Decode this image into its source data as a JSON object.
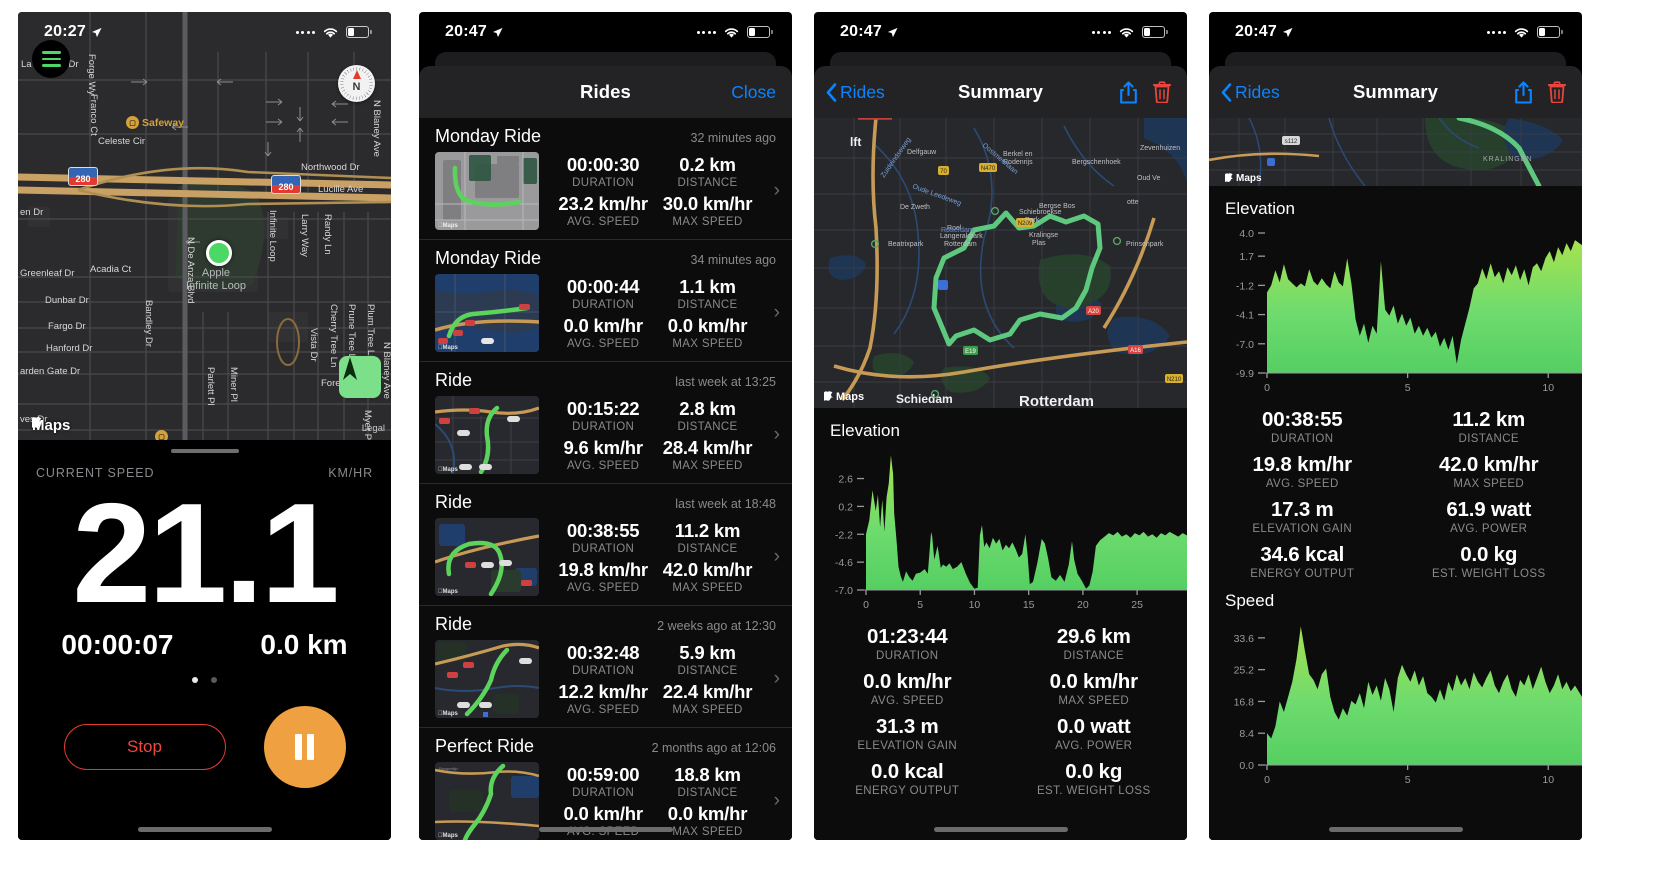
{
  "accent_blue": "#0a84ff",
  "accent_green": "#6fdc6f",
  "accent_orange": "#efa040",
  "accent_red": "#e03a32",
  "panel1": {
    "status": {
      "time": "20:27",
      "location_icon": "location-arrow-icon",
      "cellular": "....",
      "wifi_icon": "wifi-icon",
      "battery_icon": "battery-icon"
    },
    "map": {
      "attribution": "Maps",
      "legal": "Legal",
      "user_location_label": "Apple\nInfinite Loop",
      "poi": "Safeway",
      "highway_shields": [
        "280",
        "280"
      ],
      "street_labels": [
        "La Grande Dr",
        "Forge Wy",
        "Franco Ct",
        "Celeste Cir",
        "Northwood Dr",
        "N Blaney Ave",
        "Lucille Ave",
        "en Dr",
        "Greenleaf Dr",
        "Acadia Ct",
        "Dunbar Dr",
        "Fargo Dr",
        "Hanford Dr",
        "arden Gate Dr",
        "ves Dr",
        "N De Anza Blvd",
        "Bandley Dr",
        "Parlett Pl",
        "Miner Pl",
        "Infinite Loop",
        "Larry Way",
        "Randy Ln",
        "Vista Dr",
        "Cherry Tree Ln",
        "Prune Tree Ln",
        "Plum Tree Ln",
        "N Blaney Ave",
        "Forest Ave",
        "Myer Pl"
      ]
    },
    "live": {
      "speed_label": "CURRENT SPEED",
      "unit_label": "KM/HR",
      "speed_value": "21.1",
      "duration": "00:00:07",
      "distance": "0.0 km",
      "stop_label": "Stop",
      "pause_icon": "pause-icon",
      "page_count": 2,
      "page_active": 0
    }
  },
  "panel2": {
    "status": {
      "time": "20:47",
      "cellular": "....",
      "wifi_icon": "wifi-icon",
      "battery_icon": "battery-icon"
    },
    "navbar": {
      "title": "Rides",
      "close_label": "Close"
    },
    "rides": [
      {
        "name": "Monday Ride",
        "when": "32 minutes ago",
        "duration": "00:00:30",
        "distance": "0.2 km",
        "avg_speed": "23.2 km/hr",
        "max_speed": "30.0 km/hr",
        "labels": {
          "duration": "DURATION",
          "distance": "DISTANCE",
          "avg_speed": "AVG. SPEED",
          "max_speed": "MAX SPEED"
        },
        "thumb_style": "light"
      },
      {
        "name": "Monday Ride",
        "when": "34 minutes ago",
        "duration": "00:00:44",
        "distance": "1.1 km",
        "avg_speed": "0.0 km/hr",
        "max_speed": "0.0 km/hr",
        "labels": {
          "duration": "DURATION",
          "distance": "DISTANCE",
          "avg_speed": "AVG. SPEED",
          "max_speed": "MAX SPEED"
        },
        "thumb_style": "water"
      },
      {
        "name": "Ride",
        "when": "last week at 13:25",
        "duration": "00:15:22",
        "distance": "2.8 km",
        "avg_speed": "9.6 km/hr",
        "max_speed": "28.4 km/hr",
        "labels": {
          "duration": "DURATION",
          "distance": "DISTANCE",
          "avg_speed": "AVG. SPEED",
          "max_speed": "MAX SPEED"
        },
        "thumb_style": "dark"
      },
      {
        "name": "Ride",
        "when": "last week at 18:48",
        "duration": "00:38:55",
        "distance": "11.2 km",
        "avg_speed": "19.8 km/hr",
        "max_speed": "42.0 km/hr",
        "labels": {
          "duration": "DURATION",
          "distance": "DISTANCE",
          "avg_speed": "AVG. SPEED",
          "max_speed": "MAX SPEED"
        },
        "thumb_style": "loop"
      },
      {
        "name": "Ride",
        "when": "2 weeks ago at 12:30",
        "duration": "00:32:48",
        "distance": "5.9 km",
        "avg_speed": "12.2 km/hr",
        "max_speed": "22.4 km/hr",
        "labels": {
          "duration": "DURATION",
          "distance": "DISTANCE",
          "avg_speed": "AVG. SPEED",
          "max_speed": "MAX SPEED"
        },
        "thumb_style": "dark"
      },
      {
        "name": "Perfect Ride",
        "when": "2 months ago at 12:06",
        "duration": "00:59:00",
        "distance": "18.8 km",
        "avg_speed": "0.0 km/hr",
        "max_speed": "0.0 km/hr",
        "labels": {
          "duration": "DURATION",
          "distance": "DISTANCE",
          "avg_speed": "AVG. SPEED",
          "max_speed": "MAX SPEED"
        },
        "thumb_style": "dark"
      }
    ]
  },
  "panel3": {
    "status": {
      "time": "20:47",
      "cellular": "....",
      "wifi_icon": "wifi-icon",
      "battery_icon": "battery-icon"
    },
    "navbar": {
      "back_label": "Rides",
      "title": "Summary",
      "share_icon": "share-icon",
      "delete_icon": "trash-icon"
    },
    "map": {
      "attribution": "Maps",
      "place_labels": [
        "lft",
        "Delfgauw",
        "Berkel en Rodenrijs",
        "Bergschenhoek",
        "Zevenhuizen",
        "Oud Ve",
        "De Zweth",
        "Schiebroekse Park",
        "Bergse Bos",
        "otte",
        "Beatrixpark",
        "Schiedam",
        "Roel Langerakpark Rotterdam",
        "Rotterdam",
        "Prinsenpark",
        "Kralingse Plas"
      ],
      "road_shields": [
        "N470",
        "N209",
        "N219",
        "E19",
        "A20",
        "A16"
      ]
    },
    "elevation": {
      "title": "Elevation",
      "yticks": [
        "2.6",
        "0.2",
        "-2.2",
        "-4.6",
        "-7.0"
      ],
      "xticks": [
        "0",
        "5",
        "10",
        "15",
        "20",
        "25"
      ]
    },
    "stats": [
      {
        "value": "01:23:44",
        "label": "DURATION"
      },
      {
        "value": "29.6 km",
        "label": "DISTANCE"
      },
      {
        "value": "0.0 km/hr",
        "label": "AVG. SPEED"
      },
      {
        "value": "0.0 km/hr",
        "label": "MAX SPEED"
      },
      {
        "value": "31.3 m",
        "label": "ELEVATION GAIN"
      },
      {
        "value": "0.0 watt",
        "label": "AVG. POWER"
      },
      {
        "value": "0.0 kcal",
        "label": "ENERGY OUTPUT"
      },
      {
        "value": "0.0 kg",
        "label": "EST. WEIGHT LOSS"
      }
    ]
  },
  "panel4": {
    "status": {
      "time": "20:47",
      "cellular": "....",
      "wifi_icon": "wifi-icon",
      "battery_icon": "battery-icon"
    },
    "navbar": {
      "back_label": "Rides",
      "title": "Summary",
      "share_icon": "share-icon",
      "delete_icon": "trash-icon"
    },
    "map": {
      "attribution": "Maps",
      "place_labels": [
        "s112",
        "KRALINGEN"
      ]
    },
    "elevation": {
      "title": "Elevation",
      "yticks": [
        "4.0",
        "1.7",
        "-1.2",
        "-4.1",
        "-7.0",
        "-9.9"
      ],
      "xticks": [
        "0",
        "5",
        "10"
      ]
    },
    "stats": [
      {
        "value": "00:38:55",
        "label": "DURATION"
      },
      {
        "value": "11.2 km",
        "label": "DISTANCE"
      },
      {
        "value": "19.8 km/hr",
        "label": "AVG. SPEED"
      },
      {
        "value": "42.0 km/hr",
        "label": "MAX SPEED"
      },
      {
        "value": "17.3 m",
        "label": "ELEVATION GAIN"
      },
      {
        "value": "61.9 watt",
        "label": "AVG. POWER"
      },
      {
        "value": "34.6 kcal",
        "label": "ENERGY OUTPUT"
      },
      {
        "value": "0.0 kg",
        "label": "EST. WEIGHT LOSS"
      }
    ],
    "speed": {
      "title": "Speed",
      "yticks": [
        "33.6",
        "25.2",
        "16.8",
        "8.4",
        "0.0"
      ],
      "xticks": [
        "0",
        "5",
        "10"
      ]
    }
  },
  "chart_data": [
    {
      "type": "area",
      "title": "Elevation",
      "panel": 3,
      "xlabel": "",
      "ylabel": "",
      "xlim": [
        0,
        29.6
      ],
      "ylim": [
        -7.0,
        4.8
      ],
      "yticks": [
        2.6,
        0.2,
        -2.2,
        -4.6,
        -7.0
      ],
      "xticks": [
        0,
        5,
        10,
        15,
        20,
        25
      ],
      "grid": false,
      "series": [
        {
          "name": "elevation",
          "x": [
            0,
            0.3,
            0.6,
            0.9,
            1.1,
            1.3,
            1.5,
            1.7,
            1.9,
            2.1,
            2.3,
            2.5,
            2.6,
            2.8,
            3.0,
            3.2,
            3.4,
            3.7,
            4.0,
            4.3,
            4.6,
            5.0,
            5.4,
            5.7,
            6.0,
            6.1,
            6.3,
            6.6,
            6.9,
            7.1,
            7.4,
            7.7,
            8.0,
            8.4,
            8.8,
            9.2,
            9.6,
            10.0,
            10.3,
            10.5,
            10.7,
            10.9,
            11.1,
            11.4,
            11.7,
            12.0,
            12.3,
            12.6,
            12.9,
            13.2,
            13.5,
            13.8,
            14.1,
            14.4,
            14.7,
            14.9,
            15.1,
            15.4,
            15.8,
            16.2,
            16.5,
            16.8,
            17.1,
            17.5,
            17.9,
            18.3,
            18.7,
            19.0,
            19.2,
            19.5,
            19.9,
            20.3,
            20.6,
            20.9,
            21.2,
            21.6,
            22.0,
            22.4,
            22.8,
            23.2,
            23.6,
            24.0,
            24.4,
            24.8,
            25.2,
            25.6,
            26.0,
            26.4,
            26.8,
            27.2,
            27.6,
            28.0,
            28.4,
            28.8,
            29.2,
            29.6
          ],
          "y": [
            -2.2,
            -1.0,
            1.6,
            -0.2,
            1.2,
            -1.6,
            0.8,
            -2.0,
            1.0,
            2.2,
            4.6,
            3.0,
            -0.4,
            -2.6,
            -5.0,
            -5.8,
            -6.3,
            -5.4,
            -5.9,
            -6.2,
            -5.6,
            -5.5,
            -5.2,
            -5.6,
            -2.0,
            -2.4,
            -4.4,
            -3.2,
            -5.1,
            -4.8,
            -5.0,
            -4.7,
            -5.2,
            -5.0,
            -4.6,
            -5.6,
            -6.4,
            -6.9,
            -6.8,
            -2.3,
            -1.4,
            -3.3,
            -2.9,
            -3.4,
            -2.5,
            -3.0,
            -2.6,
            -3.6,
            -3.1,
            -3.4,
            -2.9,
            -3.5,
            -4.2,
            -3.9,
            -2.2,
            -4.0,
            -6.5,
            -6.3,
            -4.7,
            -2.6,
            -3.0,
            -4.3,
            -5.9,
            -6.2,
            -5.7,
            -6.3,
            -4.8,
            -2.8,
            -4.4,
            -5.6,
            -6.2,
            -6.9,
            -6.6,
            -5.4,
            -3.2,
            -2.7,
            -2.4,
            -2.1,
            -2.3,
            -2.0,
            -2.4,
            -2.2,
            -2.5,
            -2.1,
            -2.3,
            -2.0,
            -2.4,
            -2.2,
            -2.5,
            -2.1,
            -2.3,
            -2.0,
            -2.2,
            -2.4,
            -2.1,
            -2.3
          ]
        }
      ]
    },
    {
      "type": "area",
      "title": "Elevation",
      "panel": 4,
      "xlabel": "",
      "ylabel": "",
      "xlim": [
        0,
        11.2
      ],
      "ylim": [
        -9.9,
        4.0
      ],
      "yticks": [
        4.0,
        1.7,
        -1.2,
        -4.1,
        -7.0,
        -9.9
      ],
      "xticks": [
        0,
        5,
        10
      ],
      "grid": false,
      "series": [
        {
          "name": "elevation",
          "x": [
            0,
            0.15,
            0.3,
            0.45,
            0.6,
            0.75,
            0.9,
            1.05,
            1.2,
            1.35,
            1.5,
            1.65,
            1.8,
            1.95,
            2.1,
            2.25,
            2.4,
            2.55,
            2.7,
            2.85,
            3.0,
            3.15,
            3.3,
            3.45,
            3.6,
            3.75,
            3.9,
            4.05,
            4.2,
            4.35,
            4.5,
            4.65,
            4.8,
            4.95,
            5.1,
            5.25,
            5.4,
            5.55,
            5.7,
            5.85,
            6.0,
            6.15,
            6.3,
            6.45,
            6.6,
            6.75,
            6.9,
            7.05,
            7.2,
            7.35,
            7.5,
            7.65,
            7.8,
            7.95,
            8.1,
            8.25,
            8.4,
            8.55,
            8.7,
            8.85,
            9.0,
            9.15,
            9.3,
            9.45,
            9.6,
            9.75,
            9.9,
            10.05,
            10.2,
            10.35,
            10.5,
            10.65,
            10.8,
            10.95,
            11.2
          ],
          "y": [
            -1.9,
            -1.2,
            0.3,
            -0.9,
            0.9,
            -0.6,
            -1.0,
            -1.4,
            -1.0,
            -1.3,
            0.4,
            -0.8,
            -1.2,
            -0.5,
            -1.1,
            -1.5,
            0.2,
            -0.9,
            -1.3,
            1.5,
            -1.0,
            -4.6,
            -6.2,
            -5.0,
            -6.9,
            -5.2,
            -6.0,
            1.2,
            -3.6,
            -4.2,
            -3.2,
            -5.0,
            -4.0,
            -5.2,
            -4.4,
            -6.0,
            -5.2,
            -6.2,
            -5.4,
            -6.4,
            -5.8,
            -7.3,
            -6.4,
            -7.6,
            -6.2,
            -9.0,
            -6.6,
            -5.0,
            -3.4,
            -1.5,
            -1.0,
            0.5,
            -0.6,
            1.0,
            -0.4,
            0.2,
            -1.0,
            0.6,
            -0.2,
            0.8,
            -0.7,
            0.4,
            -1.2,
            0.6,
            1.0,
            0.2,
            1.5,
            2.2,
            1.1,
            2.6,
            1.8,
            3.0,
            2.2,
            3.3,
            2.8
          ]
        }
      ]
    },
    {
      "type": "area",
      "title": "Speed",
      "panel": 4,
      "xlabel": "",
      "ylabel": "",
      "xlim": [
        0,
        11.2
      ],
      "ylim": [
        0.0,
        37.0
      ],
      "yticks": [
        33.6,
        25.2,
        16.8,
        8.4,
        0.0
      ],
      "xticks": [
        0,
        5,
        10
      ],
      "grid": false,
      "series": [
        {
          "name": "speed",
          "x": [
            0,
            0.15,
            0.3,
            0.45,
            0.6,
            0.75,
            0.9,
            1.05,
            1.2,
            1.35,
            1.5,
            1.65,
            1.8,
            1.95,
            2.1,
            2.25,
            2.4,
            2.55,
            2.7,
            2.85,
            3.0,
            3.15,
            3.3,
            3.45,
            3.6,
            3.75,
            3.9,
            4.05,
            4.2,
            4.35,
            4.5,
            4.65,
            4.8,
            4.95,
            5.1,
            5.25,
            5.4,
            5.55,
            5.7,
            5.85,
            6.0,
            6.15,
            6.3,
            6.45,
            6.6,
            6.75,
            6.9,
            7.05,
            7.2,
            7.35,
            7.5,
            7.65,
            7.8,
            7.95,
            8.1,
            8.25,
            8.4,
            8.55,
            8.7,
            8.85,
            9.0,
            9.15,
            9.3,
            9.45,
            9.6,
            9.75,
            9.9,
            10.05,
            10.2,
            10.35,
            10.5,
            10.65,
            10.8,
            10.95,
            11.2
          ],
          "y": [
            8.4,
            7.0,
            10.2,
            16.8,
            14.0,
            18.0,
            22.0,
            28.0,
            36.6,
            30.0,
            24.0,
            22.5,
            20.0,
            24.0,
            25.5,
            18.0,
            14.0,
            12.0,
            15.0,
            13.0,
            17.0,
            16.0,
            19.0,
            15.0,
            22.0,
            18.5,
            21.0,
            17.0,
            23.0,
            20.0,
            14.0,
            23.0,
            26.5,
            24.0,
            22.0,
            25.0,
            21.0,
            23.5,
            19.0,
            18.0,
            16.5,
            20.0,
            17.0,
            22.0,
            19.5,
            24.0,
            21.0,
            23.0,
            20.0,
            24.5,
            22.0,
            20.5,
            23.0,
            25.0,
            21.0,
            19.0,
            22.0,
            24.0,
            20.0,
            18.0,
            22.5,
            21.0,
            24.0,
            20.0,
            23.0,
            26.0,
            22.0,
            19.0,
            21.0,
            24.0,
            20.0,
            22.0,
            19.5,
            21.0,
            18.0
          ]
        }
      ]
    }
  ]
}
